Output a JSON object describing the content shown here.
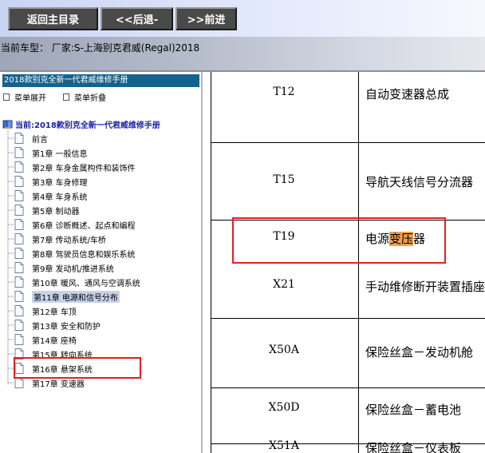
{
  "toolbar": {
    "home_label": "返回主目录",
    "back_label": "<<后退-",
    "forward_label": ">>前进"
  },
  "current_model": {
    "text": "当前车型： 厂家:S-上海别克君威(Regal)2018"
  },
  "tree": {
    "manual_title": "2018款别克全新一代君威维修手册",
    "expand_label": "菜单展开",
    "collapse_label": "菜单折叠",
    "root_label": "当前:2018款别克全新一代君威维修手册",
    "items": [
      {
        "label": "前言"
      },
      {
        "label": "第1章 一般信息"
      },
      {
        "label": "第2章 车身金属构件和装饰件"
      },
      {
        "label": "第3章 车身修理"
      },
      {
        "label": "第4章 车身系统"
      },
      {
        "label": "第5章 制动器"
      },
      {
        "label": "第6章 诊断概述、起点和编程"
      },
      {
        "label": "第7章 传动系统/车桥"
      },
      {
        "label": "第8章 驾驶员信息和娱乐系统"
      },
      {
        "label": "第9章 发动机/推进系统"
      },
      {
        "label": "第10章 暖风、通风与空调系统"
      },
      {
        "label": "第11章 电源和信号分布"
      },
      {
        "label": "第12章 车顶"
      },
      {
        "label": "第13章 安全和防护"
      },
      {
        "label": "第14章 座椅"
      },
      {
        "label": "第15章 转向系统"
      },
      {
        "label": "第16章 悬架系统"
      },
      {
        "label": "第17章 变速器"
      }
    ],
    "active_index": 11
  },
  "table": {
    "rows": [
      {
        "code": "T12",
        "desc": "自动变速器总成"
      },
      {
        "code": "T15",
        "desc": "导航天线信号分流器"
      },
      {
        "code": "T19",
        "desc_pre": "电源",
        "desc_mark": "变压",
        "desc_post": "器"
      },
      {
        "code": "X21",
        "desc": "手动维修断开装置插座"
      },
      {
        "code": "X50A",
        "desc": "保险丝盒－发动机舱"
      },
      {
        "code": "X50D",
        "desc": "保险丝盒－蓄电池"
      },
      {
        "code": "X51A",
        "desc": "保险丝盒－仪表板"
      }
    ]
  },
  "colors": {
    "tree_title_bg": "#14638d",
    "root_text": "#1a1fa8",
    "highlight_box": "#e02020",
    "search_mark": "#f3a04b"
  }
}
